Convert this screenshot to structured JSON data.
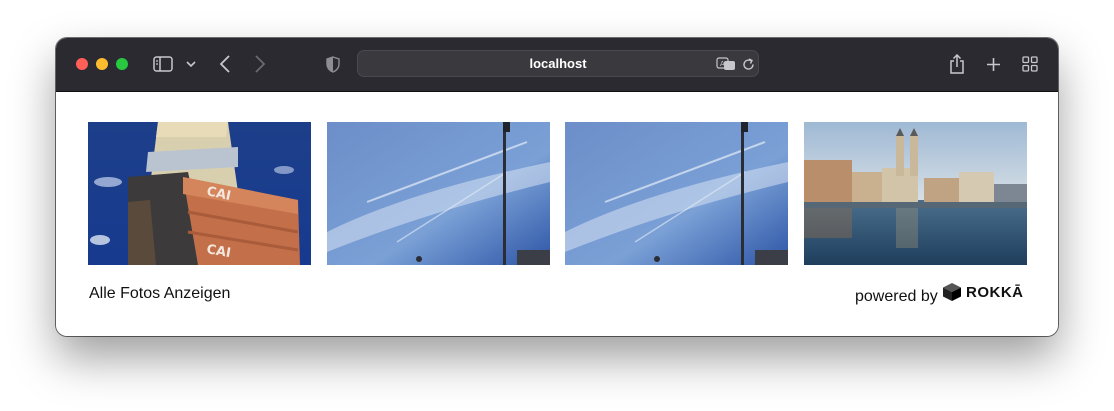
{
  "browser": {
    "url": "localhost",
    "icons": [
      "sidebar-toggle-icon",
      "chevron-down-icon",
      "back-arrow-icon",
      "forward-arrow-icon",
      "privacy-shield-icon",
      "translate-icon",
      "reload-icon",
      "share-icon",
      "new-tab-plus-icon",
      "tab-overview-icon"
    ]
  },
  "gallery": {
    "photos": [
      {
        "subject": "stacked shipping containers tower against blue sky"
      },
      {
        "subject": "blue sky with contrails and a flagpole"
      },
      {
        "subject": "blue sky with contrails and a flagpole"
      },
      {
        "subject": "Zurich Grossmünster and riverside buildings reflected in the Limmat"
      }
    ],
    "all_photos_label": "Alle Fotos Anzeigen",
    "powered_by_label": "powered by",
    "brand_name": "ROKKĀ"
  },
  "colors": {
    "toolbar": "#2b2a30",
    "close": "#fe5f57",
    "minimize": "#febc2e",
    "zoom": "#28c840"
  }
}
